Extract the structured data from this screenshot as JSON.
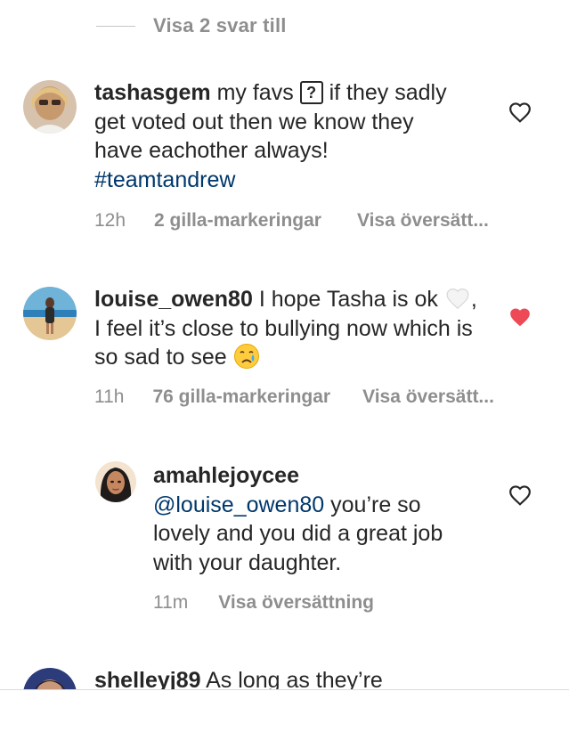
{
  "view_replies": {
    "label": "Visa 2 svar till"
  },
  "comments": [
    {
      "username": "tashasgem",
      "text_parts": [
        "my favs",
        "if they sadly get voted out then we know they have eachother always!",
        "#teamtandrew"
      ],
      "unknown_glyph": "?",
      "time": "12h",
      "likes": "2 gilla-markeringar",
      "translate": "Visa översätt...",
      "liked": false
    },
    {
      "username": "louise_owen80",
      "text_parts": [
        "I hope Tasha is ok",
        ", I feel it’s close to bullying now which is so sad to see"
      ],
      "time": "11h",
      "likes": "76 gilla-markeringar",
      "translate": "Visa översätt...",
      "liked": true
    },
    {
      "username": "amahlejoycee",
      "mention": "@louise_owen80",
      "text": "you’re so lovely and you did a great job with your daughter.",
      "time": "11m",
      "translate": "Visa översättning",
      "liked": false
    },
    {
      "username": "shelleyj89",
      "text": "As long as they’re"
    }
  ],
  "colors": {
    "text": "#262626",
    "muted": "#8e8e8e",
    "link": "#00376b",
    "like_red": "#ed4956"
  }
}
